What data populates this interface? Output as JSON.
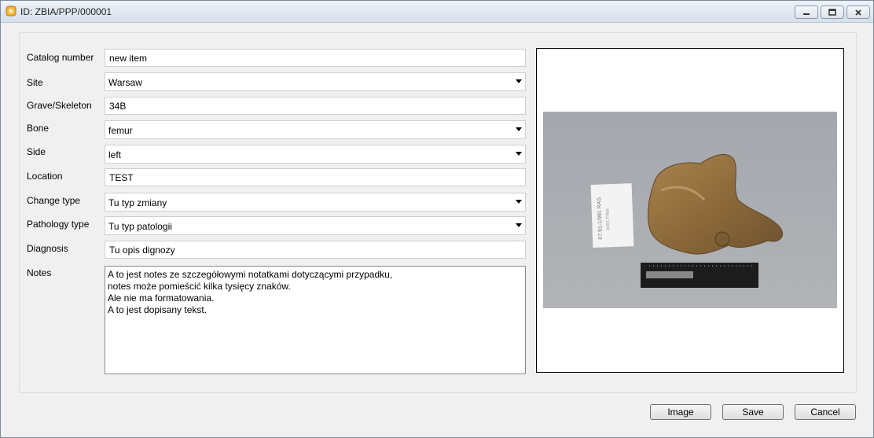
{
  "window": {
    "title": "ID: ZBIA/PPP/000001"
  },
  "form": {
    "catalog_number": {
      "label": "Catalog number",
      "value": "new item"
    },
    "site": {
      "label": "Site",
      "value": "Warsaw"
    },
    "grave": {
      "label": "Grave/Skeleton",
      "value": "34B"
    },
    "bone": {
      "label": "Bone",
      "value": "femur"
    },
    "side": {
      "label": "Side",
      "value": "left"
    },
    "location": {
      "label": "Location",
      "value": "TEST"
    },
    "change_type": {
      "label": "Change type",
      "value": "Tu typ zmiany"
    },
    "pathology_type": {
      "label": "Pathology type",
      "value": "Tu typ patologii"
    },
    "diagnosis": {
      "label": "Diagnosis",
      "value": "Tu opis dignozy"
    },
    "notes": {
      "label": "Notes",
      "value": "A to jest notes ze szczegółowymi notatkami dotyczącymi przypadku,\nnotes może pomieścić kilka tysięcy znaków.\nAle nie ma formatowania.\nA to jest dopisany tekst."
    }
  },
  "buttons": {
    "image": "Image",
    "save": "Save",
    "cancel": "Cancel"
  },
  "icons": {
    "app": "app-icon",
    "minimize": "minimize-icon",
    "maximize": "maximize-icon",
    "close": "close-icon",
    "dropdown": "chevron-down-icon"
  },
  "colors": {
    "titlebar": "#d6e0eb",
    "photo_background": "#a9adb1"
  }
}
